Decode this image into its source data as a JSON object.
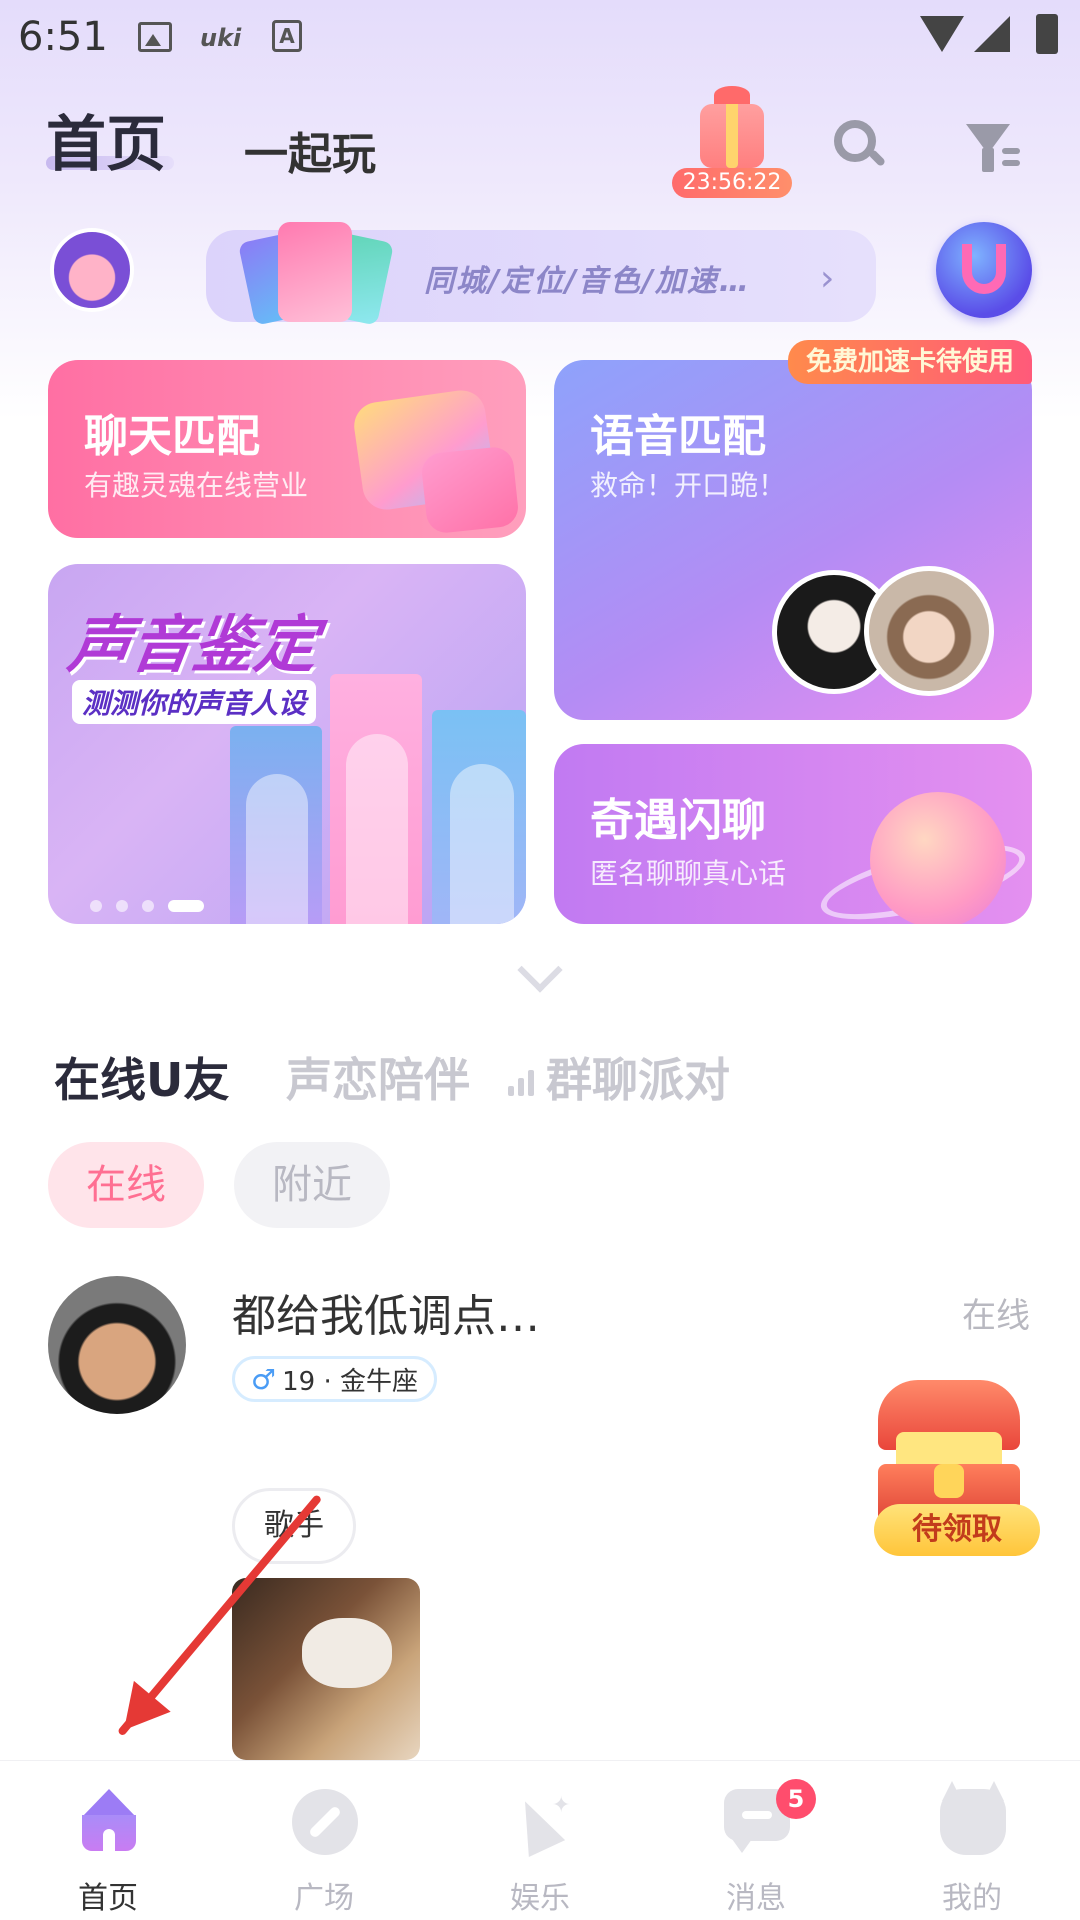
{
  "status_bar": {
    "time": "6:51",
    "icons": [
      "image-icon",
      "uki-icon",
      "accessibility-icon",
      "wifi-icon",
      "signal-icon",
      "battery-icon"
    ],
    "uki_text": "uki",
    "a_text": "A"
  },
  "header": {
    "tab_home": "首页",
    "tab_play": "一起玩",
    "gift_timer": "23:56:22",
    "icons": [
      "gift-icon",
      "search-icon",
      "filter-icon"
    ]
  },
  "banner": {
    "text": "同城/定位/音色/加速…",
    "chevron": "›"
  },
  "cards": {
    "chat_match": {
      "title": "聊天匹配",
      "subtitle": "有趣灵魂在线营业"
    },
    "voice_match": {
      "title": "语音匹配",
      "subtitle": "救命！开口跪！",
      "badge": "免费加速卡待使用"
    },
    "voice_test": {
      "title": "声音鉴定",
      "subtitle": "测测你的声音人设",
      "dots": 4,
      "active_dot": 4
    },
    "encounter": {
      "title": "奇遇闪聊",
      "subtitle": "匿名聊聊真心话"
    }
  },
  "sections": {
    "tabs": [
      "在线U友",
      "声恋陪伴",
      "群聊派对"
    ],
    "active_tab": 0
  },
  "filters": {
    "chips": [
      "在线",
      "附近"
    ],
    "active_chip": 0
  },
  "user": {
    "name": "都给我低调点…",
    "status": "在线",
    "gender_symbol": "♂",
    "tag": "19 · 金牛座",
    "skill": "歌手"
  },
  "treasure": {
    "label": "待领取"
  },
  "bottom_nav": {
    "items": [
      "首页",
      "广场",
      "娱乐",
      "消息",
      "我的"
    ],
    "active": 0,
    "message_badge": "5"
  },
  "colors": {
    "accent_pink": "#ff6f92",
    "purple": "#9c7cf5",
    "annotation_arrow": "#e53935"
  }
}
